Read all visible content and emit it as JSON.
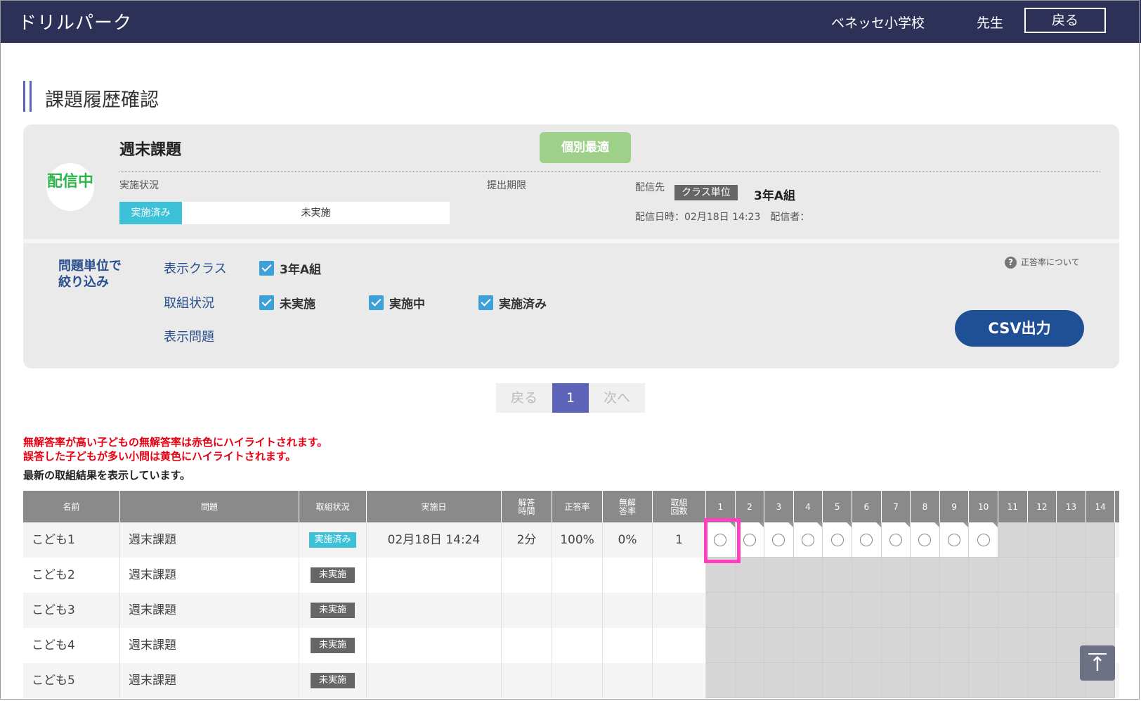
{
  "header": {
    "brand": "ドリルパーク",
    "school": "ベネッセ小学校",
    "teacher": "先生",
    "back": "戻る"
  },
  "page_title": "課題履歴確認",
  "assignment": {
    "status": "配信中",
    "name": "週末課題",
    "type_badge": "個別最適",
    "progress_label": "実施状況",
    "progress_done_label": "実施済み",
    "progress_rest_label": "未実施",
    "progress_done_fraction": 0.19,
    "deadline_label": "提出期限",
    "dest_label": "配信先",
    "dest_unit": "クラス単位",
    "dest_class": "3年A組",
    "delivery_info": "配信日時：02月18日 14:23　配信者："
  },
  "filters": {
    "title_line1": "問題単位で",
    "title_line2": "絞り込み",
    "class_label": "表示クラス",
    "class_option": "3年A組",
    "status_label": "取組状況",
    "status_options": [
      "未実施",
      "実施中",
      "実施済み"
    ],
    "question_label": "表示問題",
    "help": "正答率について",
    "help_icon": "?",
    "csv": "CSV出力"
  },
  "pager": {
    "prev": "戻る",
    "current": "1",
    "next": "次へ"
  },
  "notes": {
    "red1": "無解答率が高い子どもの無解答率は赤色にハイライトされます。",
    "red2": "誤答した子どもが多い小問は黄色にハイライトされます。",
    "black": "最新の取組結果を表示しています。"
  },
  "table": {
    "headers": {
      "name": "名前",
      "problem": "問題",
      "status": "取組状況",
      "date": "実施日",
      "time1": "解答",
      "time2": "時間",
      "rate": "正答率",
      "blank1": "無解",
      "blank2": "答率",
      "count1": "取組",
      "count2": "回数"
    },
    "question_numbers": [
      "1",
      "2",
      "3",
      "4",
      "5",
      "6",
      "7",
      "8",
      "9",
      "10",
      "11",
      "12",
      "13",
      "14"
    ],
    "rows": [
      {
        "name": "こども1",
        "problem": "週末課題",
        "status": "実施済み",
        "date": "02月18日 14:24",
        "time": "2分",
        "rate": "100%",
        "blank": "0%",
        "count": "1"
      },
      {
        "name": "こども2",
        "problem": "週末課題",
        "status": "未実施",
        "date": "",
        "time": "",
        "rate": "",
        "blank": "",
        "count": ""
      },
      {
        "name": "こども3",
        "problem": "週末課題",
        "status": "未実施",
        "date": "",
        "time": "",
        "rate": "",
        "blank": "",
        "count": ""
      },
      {
        "name": "こども4",
        "problem": "週末課題",
        "status": "未実施",
        "date": "",
        "time": "",
        "rate": "",
        "blank": "",
        "count": ""
      },
      {
        "name": "こども5",
        "problem": "週末課題",
        "status": "未実施",
        "date": "",
        "time": "",
        "rate": "",
        "blank": "",
        "count": ""
      }
    ],
    "answered_questions_row1": 10
  },
  "scroll_top_icon": "↑"
}
